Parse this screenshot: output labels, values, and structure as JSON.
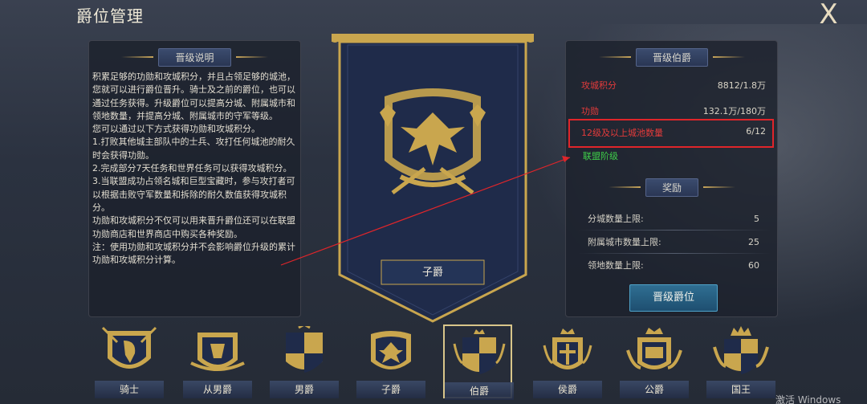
{
  "header": {
    "title": "爵位管理",
    "close_symbol": "X"
  },
  "left": {
    "section_title": "晋级说明",
    "paragraphs": [
      "积累足够的功勋和攻城积分，并且占领足够的城池，您就可以进行爵位晋升。骑士及之前的爵位，也可以通过任务获得。升级爵位可以提高分城、附属城市和领地数量，并提高分城、附属城市的守军等级。",
      "您可以通过以下方式获得功勋和攻城积分。",
      "1.打败其他城主部队中的士兵、攻打任何城池的耐久时会获得功勋。",
      "2.完成部分7天任务和世界任务可以获得攻城积分。",
      "3.当联盟成功占领名城和巨型宝藏时，参与攻打者可以根据击败守军数量和拆除的耐久数值获得攻城积分。",
      "功勋和攻城积分不仅可以用来晋升爵位还可以在联盟功勋商店和世界商店中购买各种奖励。",
      "注：使用功勋和攻城积分并不会影响爵位升级的累计功勋和攻城积分计算。"
    ]
  },
  "center": {
    "rank_name": "子爵"
  },
  "right": {
    "section_title": "晋级伯爵",
    "requirements": [
      {
        "label": "攻城积分",
        "value": "8812/1.8万"
      },
      {
        "label": "功勋",
        "value": "132.1万/180万"
      },
      {
        "label": "12级及以上城池数量",
        "value": "6/12"
      }
    ],
    "alliance_label": "联盟阶级",
    "reward_title": "奖励",
    "rewards": [
      {
        "label": "分城数量上限:",
        "value": "5"
      },
      {
        "label": "附属城市数量上限:",
        "value": "25"
      },
      {
        "label": "领地数量上限:",
        "value": "60"
      }
    ],
    "promote_button": "晋级爵位"
  },
  "ranks": [
    {
      "name": "骑士"
    },
    {
      "name": "从男爵"
    },
    {
      "name": "男爵"
    },
    {
      "name": "子爵"
    },
    {
      "name": "伯爵"
    },
    {
      "name": "侯爵"
    },
    {
      "name": "公爵"
    },
    {
      "name": "国王"
    }
  ],
  "watermark": "激活 Windows",
  "colors": {
    "gold": "#c9a64e",
    "navy": "#1f2b4a",
    "red": "#e0252a",
    "green": "#3fd04a",
    "button": "#2f6e92"
  }
}
